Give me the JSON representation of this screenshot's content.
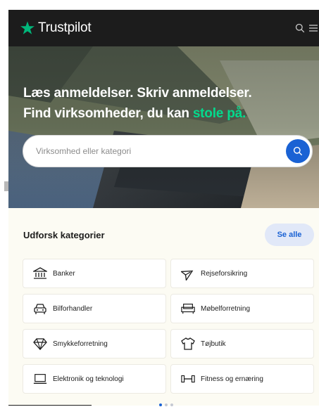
{
  "header": {
    "brand": "Trustpilot",
    "icons": [
      "search-icon",
      "menu-icon"
    ]
  },
  "hero": {
    "line1": "Læs anmeldelser. Skriv anmeldelser.",
    "line2_prefix": "Find virksomheder, du kan ",
    "line2_accent": "stole på."
  },
  "search": {
    "placeholder": "Virksomhed eller kategori",
    "value": ""
  },
  "categories": {
    "title": "Udforsk kategorier",
    "see_all": "Se alle",
    "items": [
      {
        "label": "Banker",
        "icon": "bank-icon"
      },
      {
        "label": "Rejseforsikring",
        "icon": "plane-icon"
      },
      {
        "label": "Bilforhandler",
        "icon": "car-icon"
      },
      {
        "label": "Møbelforretning",
        "icon": "sofa-icon"
      },
      {
        "label": "Smykkeforretning",
        "icon": "diamond-icon"
      },
      {
        "label": "Tøjbutik",
        "icon": "shirt-icon"
      },
      {
        "label": "Elektronik og teknologi",
        "icon": "laptop-icon"
      },
      {
        "label": "Fitness og ernæring",
        "icon": "dumbbell-icon"
      }
    ]
  },
  "colors": {
    "brand_green": "#00b67a",
    "accent_green": "#04da8d",
    "primary_blue": "#1a62d4",
    "header_bg": "#1c1c1c",
    "page_bg": "#fcfbf3"
  }
}
